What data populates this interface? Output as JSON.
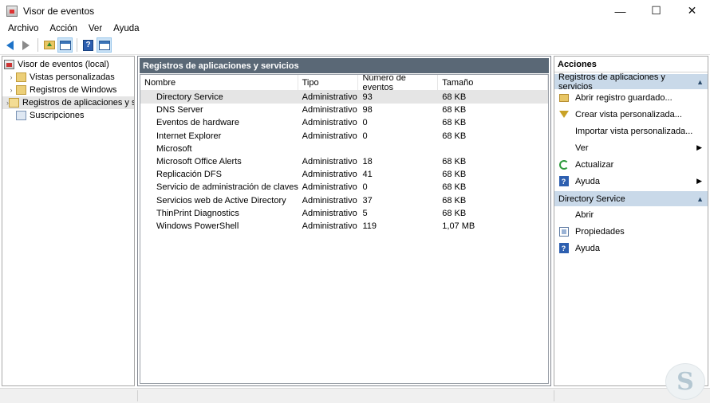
{
  "window": {
    "title": "Visor de eventos",
    "controls": {
      "minimize": "—",
      "maximize": "☐",
      "close": "✕"
    }
  },
  "menu": [
    "Archivo",
    "Acción",
    "Ver",
    "Ayuda"
  ],
  "toolbar": {
    "icons": [
      "back-arrow-icon",
      "forward-arrow-icon",
      "folder-up-icon",
      "console-tree-icon",
      "help-icon",
      "action-pane-icon"
    ]
  },
  "tree": {
    "root": "Visor de eventos (local)",
    "items": [
      {
        "label": "Vistas personalizadas",
        "expandable": true
      },
      {
        "label": "Registros de Windows",
        "expandable": true
      },
      {
        "label": "Registros de aplicaciones y s",
        "expandable": true,
        "selected": true
      },
      {
        "label": "Suscripciones",
        "expandable": false
      }
    ]
  },
  "center": {
    "header": "Registros de aplicaciones y servicios",
    "columns": [
      "Nombre",
      "Tipo",
      "Número de eventos",
      "Tamaño"
    ],
    "rows": [
      [
        "Directory Service",
        "Administrativo",
        "93",
        "68 KB"
      ],
      [
        "DNS Server",
        "Administrativo",
        "98",
        "68 KB"
      ],
      [
        "Eventos de hardware",
        "Administrativo",
        "0",
        "68 KB"
      ],
      [
        "Internet Explorer",
        "Administrativo",
        "0",
        "68 KB"
      ],
      [
        "Microsoft",
        "",
        "",
        ""
      ],
      [
        "Microsoft Office Alerts",
        "Administrativo",
        "18",
        "68 KB"
      ],
      [
        "Replicación DFS",
        "Administrativo",
        "41",
        "68 KB"
      ],
      [
        "Servicio de administración de claves",
        "Administrativo",
        "0",
        "68 KB"
      ],
      [
        "Servicios web de Active Directory",
        "Administrativo",
        "37",
        "68 KB"
      ],
      [
        "ThinPrint Diagnostics",
        "Administrativo",
        "5",
        "68 KB"
      ],
      [
        "Windows PowerShell",
        "Administrativo",
        "119",
        "1,07 MB"
      ]
    ]
  },
  "actions": {
    "title": "Acciones",
    "section1": {
      "label": "Registros de aplicaciones y servicios",
      "items": [
        {
          "label": "Abrir registro guardado...",
          "icon": "open-folder-icon"
        },
        {
          "label": "Crear vista personalizada...",
          "icon": "filter-icon"
        },
        {
          "label": "Importar vista personalizada...",
          "icon": ""
        },
        {
          "label": "Ver",
          "icon": "",
          "submenu": true
        },
        {
          "label": "Actualizar",
          "icon": "refresh-icon"
        },
        {
          "label": "Ayuda",
          "icon": "help-icon",
          "submenu": true
        }
      ]
    },
    "section2": {
      "label": "Directory Service",
      "items": [
        {
          "label": "Abrir",
          "icon": ""
        },
        {
          "label": "Propiedades",
          "icon": "properties-icon"
        },
        {
          "label": "Ayuda",
          "icon": "help-icon"
        }
      ]
    }
  },
  "colors": {
    "center_header_bg": "#5a6876",
    "action_section_bg": "#c9d9e9",
    "selection_bg": "#e5e5e5"
  }
}
